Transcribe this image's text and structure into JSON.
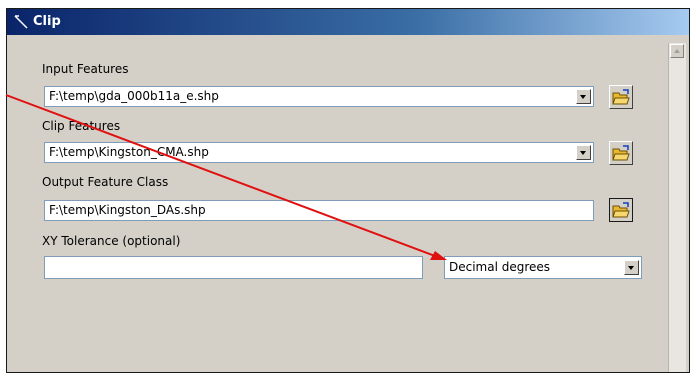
{
  "window": {
    "title": "Clip",
    "icon": "clip-tool-icon"
  },
  "form": {
    "input_features": {
      "label": "Input Features",
      "value": "F:\\temp\\gda_000b11a_e.shp"
    },
    "clip_features": {
      "label": "Clip Features",
      "value": "F:\\temp\\Kingston_CMA.shp"
    },
    "output_feature_class": {
      "label": "Output Feature Class",
      "value": "F:\\temp\\Kingston_DAs.shp"
    },
    "xy_tolerance": {
      "label": "XY Tolerance (optional)",
      "value": "",
      "unit": "Decimal degrees"
    }
  },
  "colors": {
    "annotation_arrow": "#e01010",
    "titlebar": "#0a246a",
    "folder": "#f0c040"
  },
  "icons": [
    "open-folder-icon",
    "chevron-down-icon",
    "scroll-up-icon"
  ]
}
